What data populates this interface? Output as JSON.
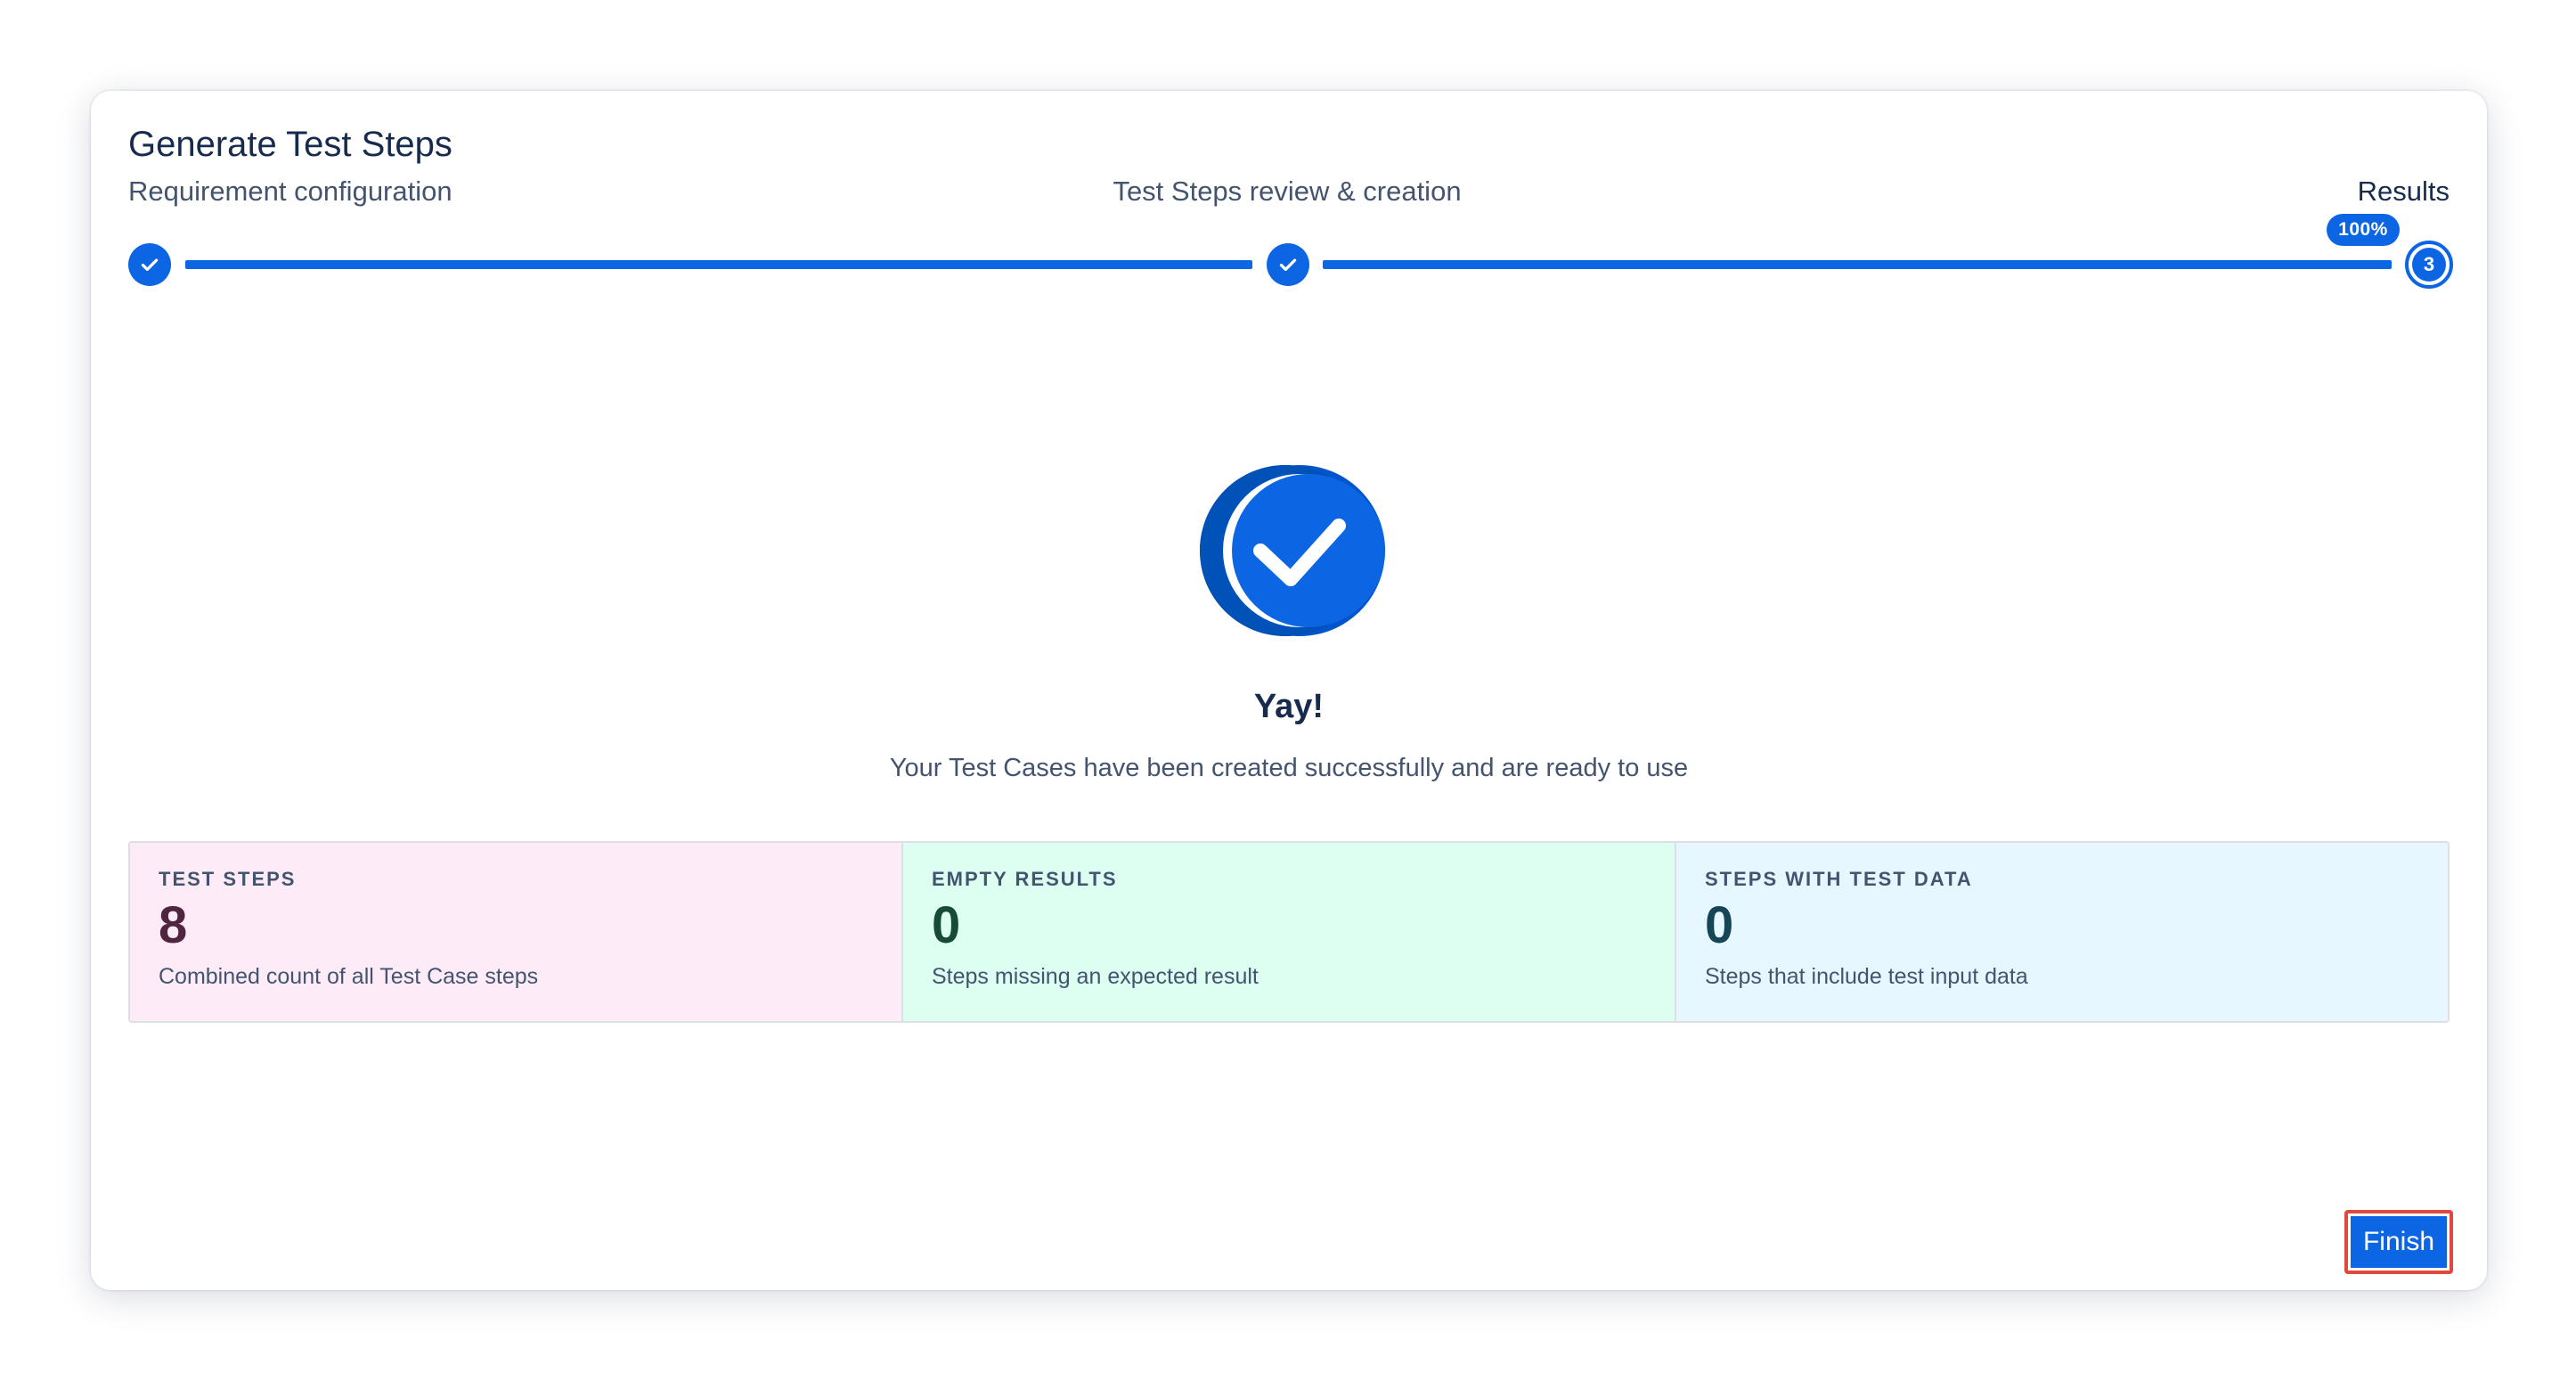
{
  "modal": {
    "title": "Generate Test Steps"
  },
  "stepper": {
    "steps": [
      {
        "label": "Requirement configuration",
        "state": "complete"
      },
      {
        "label": "Test Steps review & creation",
        "state": "complete"
      },
      {
        "label": "Results",
        "state": "current",
        "number": "3"
      }
    ],
    "progress_label": "100%",
    "progress_value": 1.0
  },
  "success": {
    "icon": "check-circle-icon",
    "heading": "Yay!",
    "message": "Your Test Cases have been created successfully and are ready to use"
  },
  "stats": [
    {
      "label": "TEST STEPS",
      "value": "8",
      "description": "Combined count of all Test Case steps"
    },
    {
      "label": "EMPTY RESULTS",
      "value": "0",
      "description": "Steps missing an expected result"
    },
    {
      "label": "STEPS WITH TEST DATA",
      "value": "0",
      "description": "Steps that include test input data"
    }
  ],
  "footer": {
    "finish_label": "Finish"
  },
  "colors": {
    "brand": "#0c66e4",
    "highlight_outline": "#e2483d",
    "card_pink": "#fdecf7",
    "card_green": "#dcfff1",
    "card_blue": "#e7f7ff"
  }
}
